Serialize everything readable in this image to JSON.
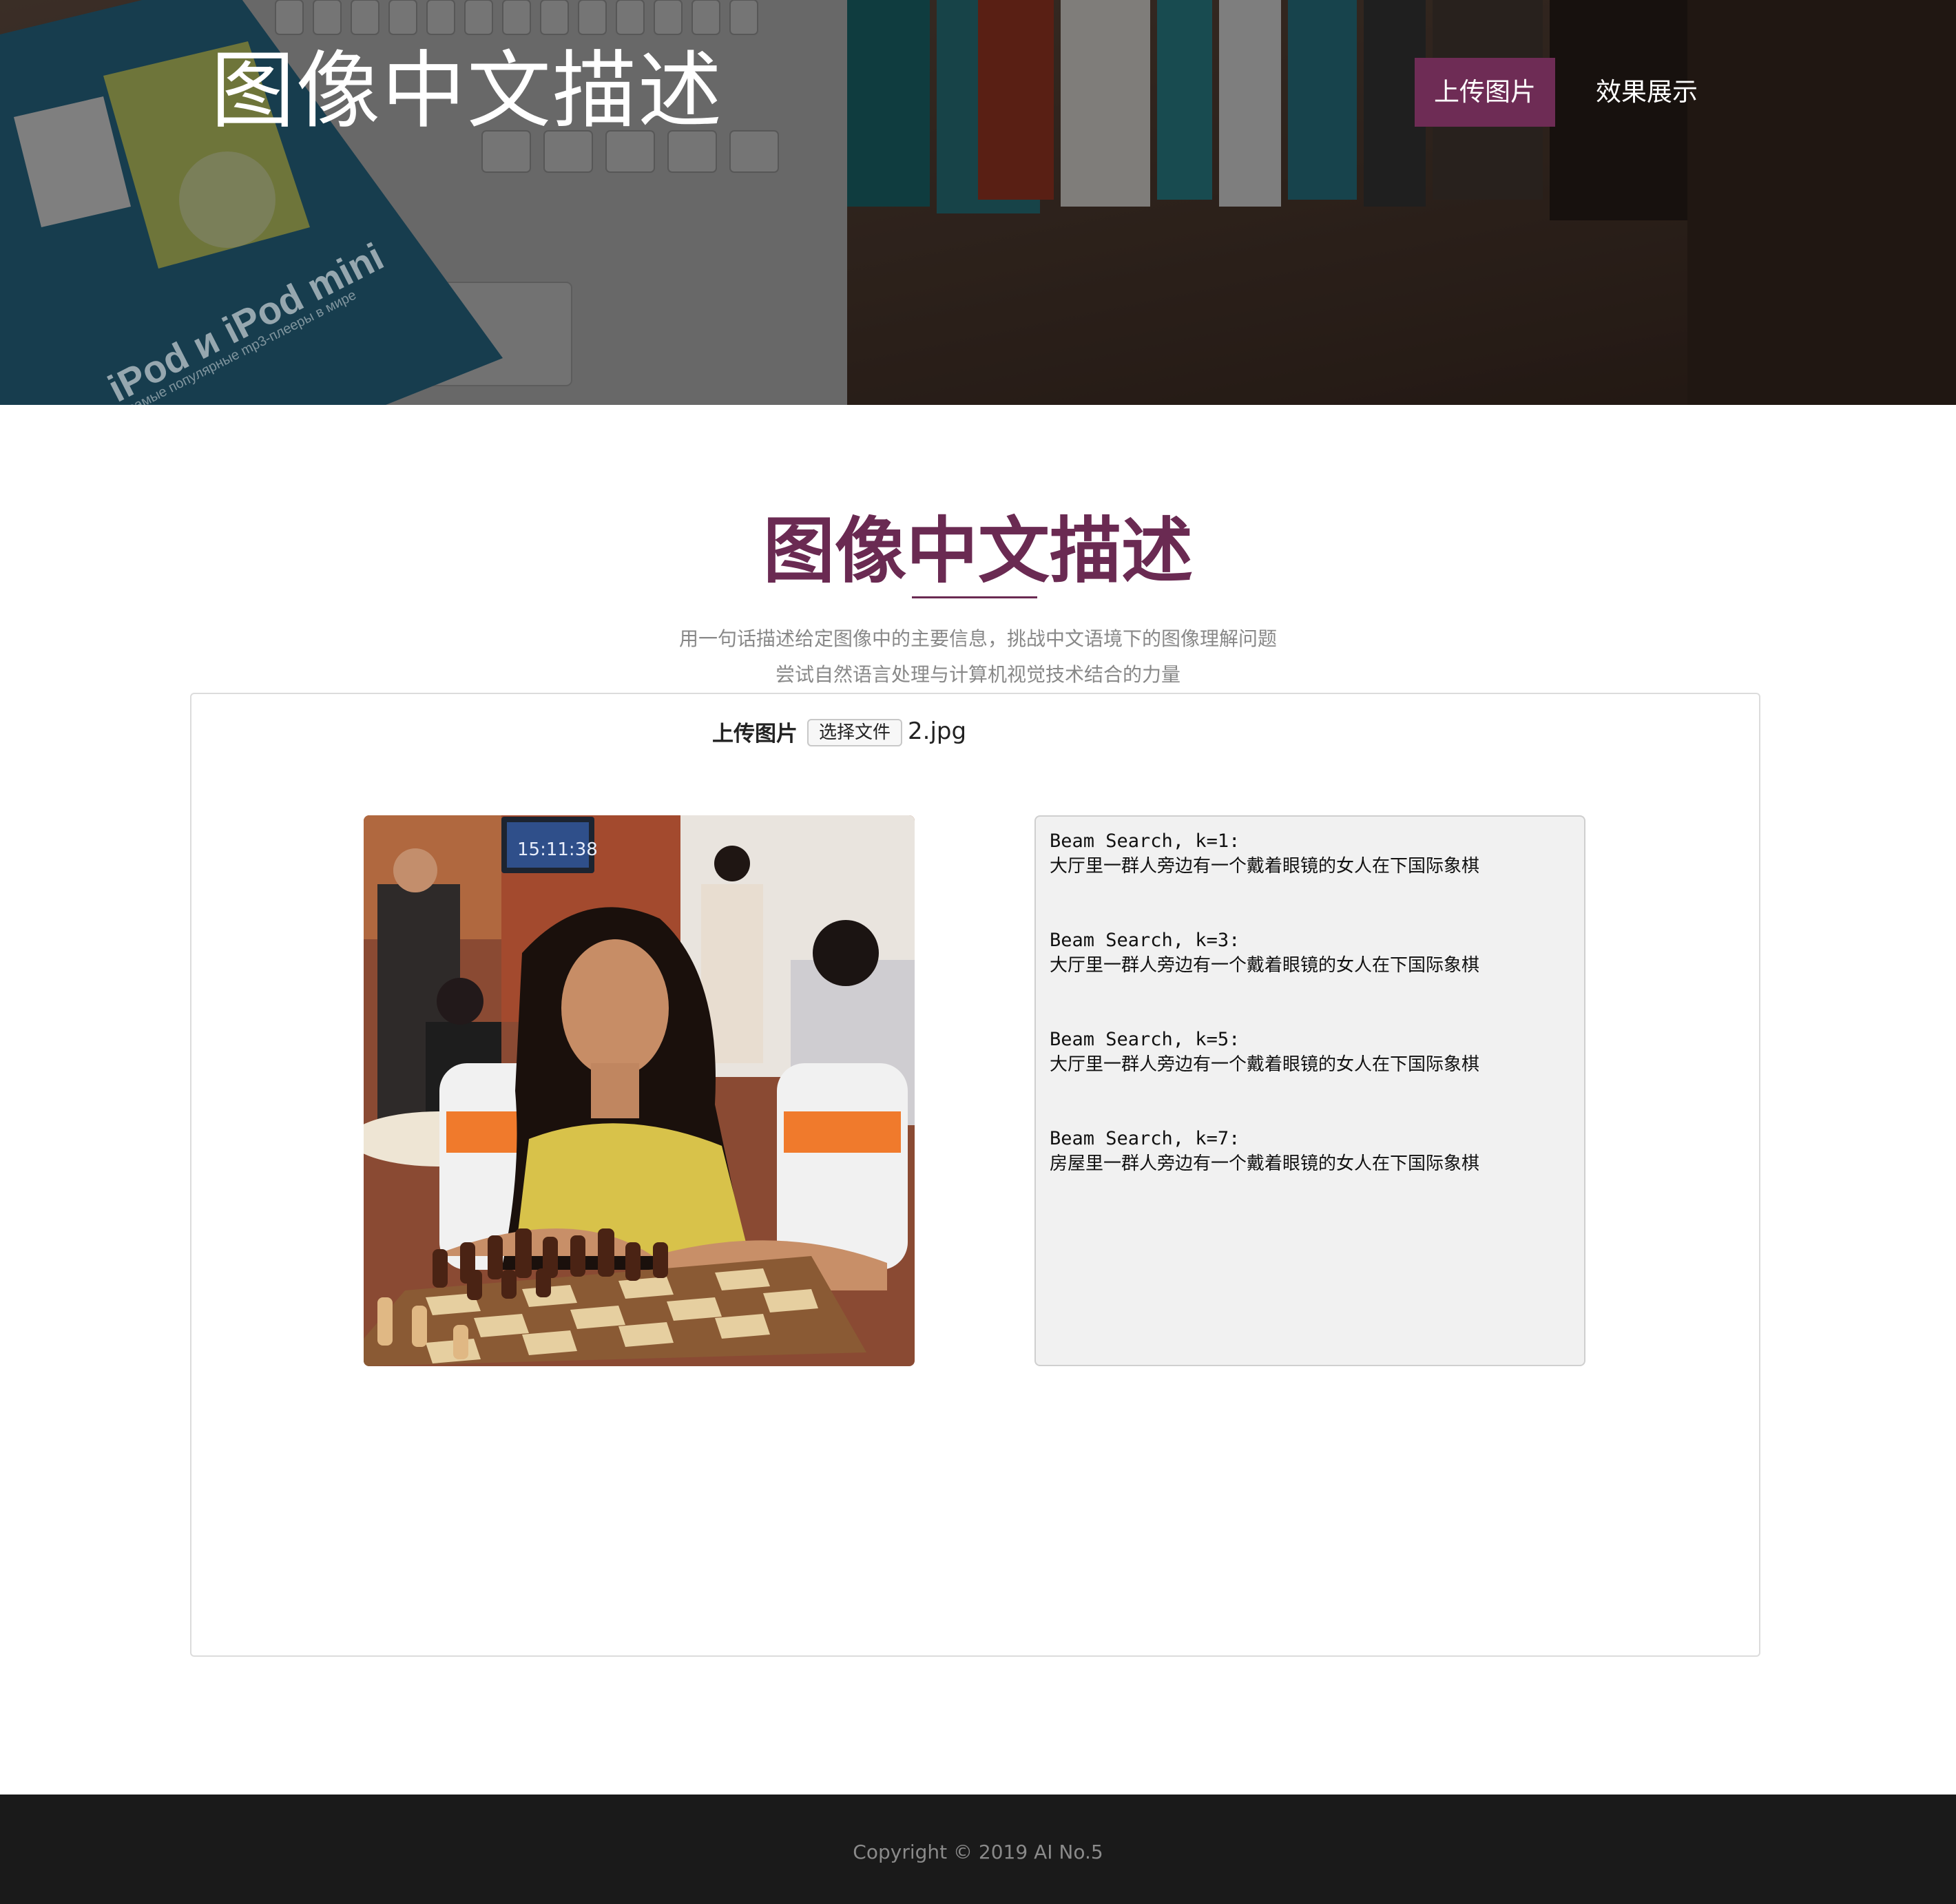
{
  "header": {
    "site_title": "图像中文描述",
    "nav": {
      "upload_label": "上传图片",
      "demo_label": "效果展示"
    },
    "background_text": {
      "book_line1": "iPod и iPod mini",
      "book_line2": "самые популярные mp3-плееры в мире"
    }
  },
  "section": {
    "title": "图像中文描述",
    "subtitle_line1": "用一句话描述给定图像中的主要信息，挑战中文语境下的图像理解问题",
    "subtitle_line2": "尝试自然语言处理与计算机视觉技术结合的力量"
  },
  "upload": {
    "label": "上传图片",
    "choose_file_button": "选择文件",
    "file_name": "2.jpg"
  },
  "photo": {
    "clock_text": "15:11:38"
  },
  "captions": [
    {
      "heading": "Beam Search, k=1:",
      "text": "大厅里一群人旁边有一个戴着眼镜的女人在下国际象棋"
    },
    {
      "heading": "Beam Search, k=3:",
      "text": "大厅里一群人旁边有一个戴着眼镜的女人在下国际象棋"
    },
    {
      "heading": "Beam Search, k=5:",
      "text": "大厅里一群人旁边有一个戴着眼镜的女人在下国际象棋"
    },
    {
      "heading": "Beam Search, k=7:",
      "text": "房屋里一群人旁边有一个戴着眼镜的女人在下国际象棋"
    }
  ],
  "footer": {
    "copyright": "Copyright © 2019 AI No.5"
  },
  "colors": {
    "accent": "#6e2c55",
    "title": "#6a2a52",
    "footer_bg": "#1a1a1a"
  }
}
